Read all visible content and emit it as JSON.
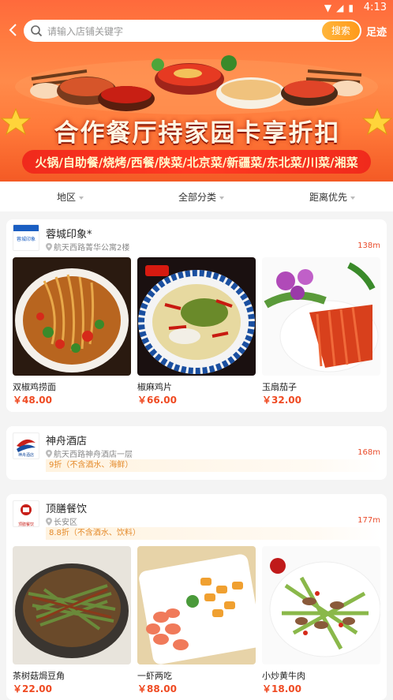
{
  "status": {
    "time": "4:13"
  },
  "search": {
    "placeholder": "请输入店铺关键字",
    "button": "搜索"
  },
  "header": {
    "footprint": "足迹"
  },
  "banner": {
    "title": "合作餐厅持家园卡享折扣",
    "subtitle": "火锅/自助餐/烧烤/西餐/陕菜/北京菜/新疆菜/东北菜/川菜/湘菜"
  },
  "filters": [
    "地区",
    "全部分类",
    "距离优先"
  ],
  "shops": [
    {
      "name": "蓉城印象*",
      "logo_text": "蓉城印象",
      "address": "航天西路菁华公寓2楼",
      "distance": "138m",
      "dishes": [
        {
          "name": "双椒鸡捞面",
          "price": "￥48.00"
        },
        {
          "name": "椒麻鸡片",
          "price": "￥66.00"
        },
        {
          "name": "玉扇茄子",
          "price": "￥32.00"
        }
      ]
    },
    {
      "name": "神舟酒店",
      "logo_text": "神舟酒店",
      "address": "航天西路神舟酒店一层",
      "distance": "168m",
      "discount": "9折（不含酒水、海鲜）"
    },
    {
      "name": "顶膳餐饮",
      "logo_text": "顶膳餐饮",
      "address": "长安区",
      "distance": "177m",
      "discount": "8.8折（不含酒水、饮料）",
      "dishes": [
        {
          "name": "茶树菇焗豆角",
          "price": "￥22.00"
        },
        {
          "name": "一虾两吃",
          "price": "￥88.00"
        },
        {
          "name": "小炒黄牛肉",
          "price": "￥18.00"
        }
      ]
    }
  ],
  "colors": {
    "accent": "#ff7a3f",
    "price": "#ef4a22",
    "discount": "#e48a2a"
  }
}
